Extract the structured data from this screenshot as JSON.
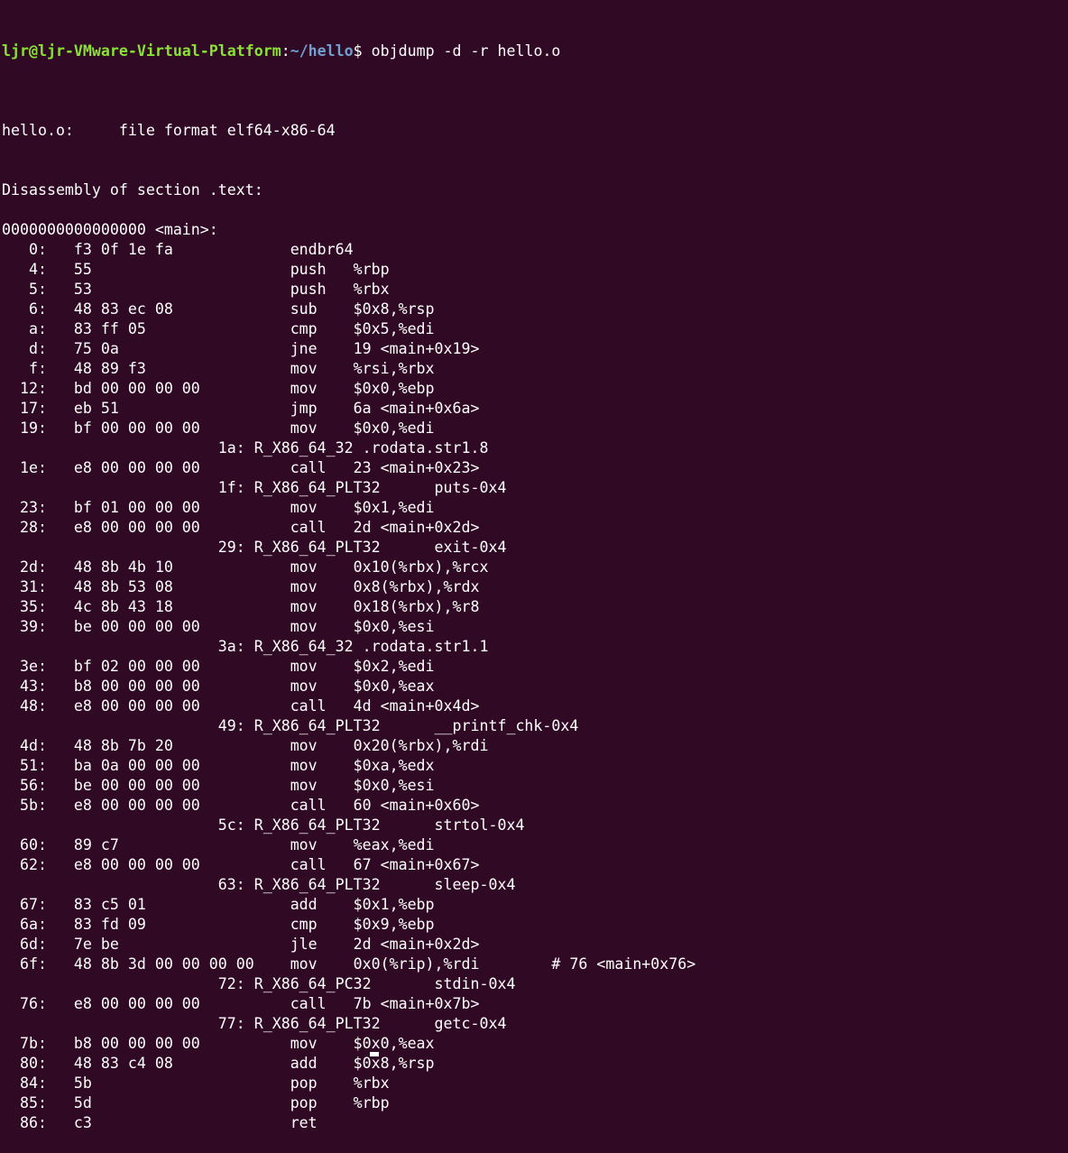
{
  "terminal": {
    "prompt": {
      "user_host": "ljr@ljr-VMware-Virtual-Platform",
      "separator": ":",
      "path": "~/hello",
      "symbol": "$ ",
      "command": "objdump -d -r hello.o"
    },
    "output_lines": [
      "",
      "hello.o:     file format elf64-x86-64",
      "",
      "",
      "Disassembly of section .text:",
      "",
      "0000000000000000 <main>:",
      "   0:\tf3 0f 1e fa          \tendbr64",
      "   4:\t55                   \tpush   %rbp",
      "   5:\t53                   \tpush   %rbx",
      "   6:\t48 83 ec 08          \tsub    $0x8,%rsp",
      "   a:\t83 ff 05             \tcmp    $0x5,%edi",
      "   d:\t75 0a                \tjne    19 <main+0x19>",
      "   f:\t48 89 f3             \tmov    %rsi,%rbx",
      "  12:\tbd 00 00 00 00       \tmov    $0x0,%ebp",
      "  17:\teb 51                \tjmp    6a <main+0x6a>",
      "  19:\tbf 00 00 00 00       \tmov    $0x0,%edi",
      "\t\t\t1a: R_X86_64_32\t.rodata.str1.8",
      "  1e:\te8 00 00 00 00       \tcall   23 <main+0x23>",
      "\t\t\t1f: R_X86_64_PLT32\tputs-0x4",
      "  23:\tbf 01 00 00 00       \tmov    $0x1,%edi",
      "  28:\te8 00 00 00 00       \tcall   2d <main+0x2d>",
      "\t\t\t29: R_X86_64_PLT32\texit-0x4",
      "  2d:\t48 8b 4b 10          \tmov    0x10(%rbx),%rcx",
      "  31:\t48 8b 53 08          \tmov    0x8(%rbx),%rdx",
      "  35:\t4c 8b 43 18          \tmov    0x18(%rbx),%r8",
      "  39:\tbe 00 00 00 00       \tmov    $0x0,%esi",
      "\t\t\t3a: R_X86_64_32\t.rodata.str1.1",
      "  3e:\tbf 02 00 00 00       \tmov    $0x2,%edi",
      "  43:\tb8 00 00 00 00       \tmov    $0x0,%eax",
      "  48:\te8 00 00 00 00       \tcall   4d <main+0x4d>",
      "\t\t\t49: R_X86_64_PLT32\t__printf_chk-0x4",
      "  4d:\t48 8b 7b 20          \tmov    0x20(%rbx),%rdi",
      "  51:\tba 0a 00 00 00       \tmov    $0xa,%edx",
      "  56:\tbe 00 00 00 00       \tmov    $0x0,%esi",
      "  5b:\te8 00 00 00 00       \tcall   60 <main+0x60>",
      "\t\t\t5c: R_X86_64_PLT32\tstrtol-0x4",
      "  60:\t89 c7                \tmov    %eax,%edi",
      "  62:\te8 00 00 00 00       \tcall   67 <main+0x67>",
      "\t\t\t63: R_X86_64_PLT32\tsleep-0x4",
      "  67:\t83 c5 01             \tadd    $0x1,%ebp",
      "  6a:\t83 fd 09             \tcmp    $0x9,%ebp",
      "  6d:\t7e be                \tjle    2d <main+0x2d>",
      "  6f:\t48 8b 3d 00 00 00 00 \tmov    0x0(%rip),%rdi        # 76 <main+0x76>",
      "\t\t\t72: R_X86_64_PC32\tstdin-0x4",
      "  76:\te8 00 00 00 00       \tcall   7b <main+0x7b>",
      "\t\t\t77: R_X86_64_PLT32\tgetc-0x4",
      "  7b:\tb8 00 00 00 00       \tmov    $0x0,%eax",
      "  80:\t48 83 c4 08          \tadd    $0x8,%rsp",
      "  84:\t5b                   \tpop    %rbx",
      "  85:\t5d                   \tpop    %rbp",
      "  86:\tc3                   \tret"
    ]
  },
  "colors": {
    "background": "#300a24",
    "foreground": "#ffffff",
    "prompt_user": "#8ae234",
    "prompt_path": "#729fcf"
  }
}
